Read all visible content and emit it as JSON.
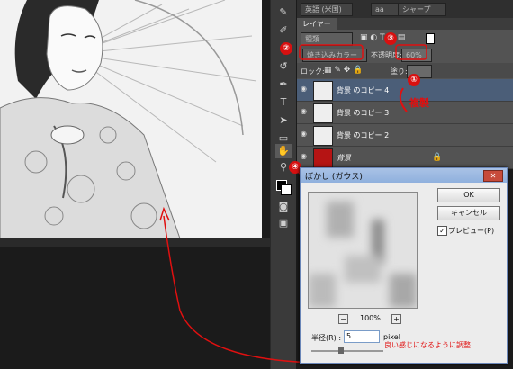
{
  "top_options": {
    "lang": "英語 (米国)",
    "aa": "aa",
    "sharp": "シャープ"
  },
  "panel": {
    "tab": "レイヤー",
    "filter_kind": "種類",
    "blend_mode": "焼き込みカラー",
    "opacity_label": "不透明度:",
    "opacity_value": "60%",
    "lock_label": "ロック:",
    "fill_label": "塗り:",
    "layers": [
      {
        "name": "背景 のコピー 4",
        "selected": true
      },
      {
        "name": "背景 のコピー 3",
        "selected": false
      },
      {
        "name": "背景 のコピー 2",
        "selected": false
      },
      {
        "name": "背景",
        "selected": false
      }
    ]
  },
  "annotations": {
    "n1": "①",
    "n1_text": "複製",
    "n2": "②",
    "n3": "③",
    "n4": "④",
    "bottom": "良い感じになるように調整"
  },
  "dialog": {
    "title": "ぼかし (ガウス)",
    "ok": "OK",
    "cancel": "キャンセル",
    "preview_label": "プレビュー(P)",
    "zoom_minus": "−",
    "zoom": "100%",
    "zoom_plus": "+",
    "radius_label": "半径(R) :",
    "radius_value": "5",
    "radius_unit": "pixel"
  },
  "colors": {
    "accent_red": "#e01010",
    "selected_layer": "#4b5e78"
  }
}
